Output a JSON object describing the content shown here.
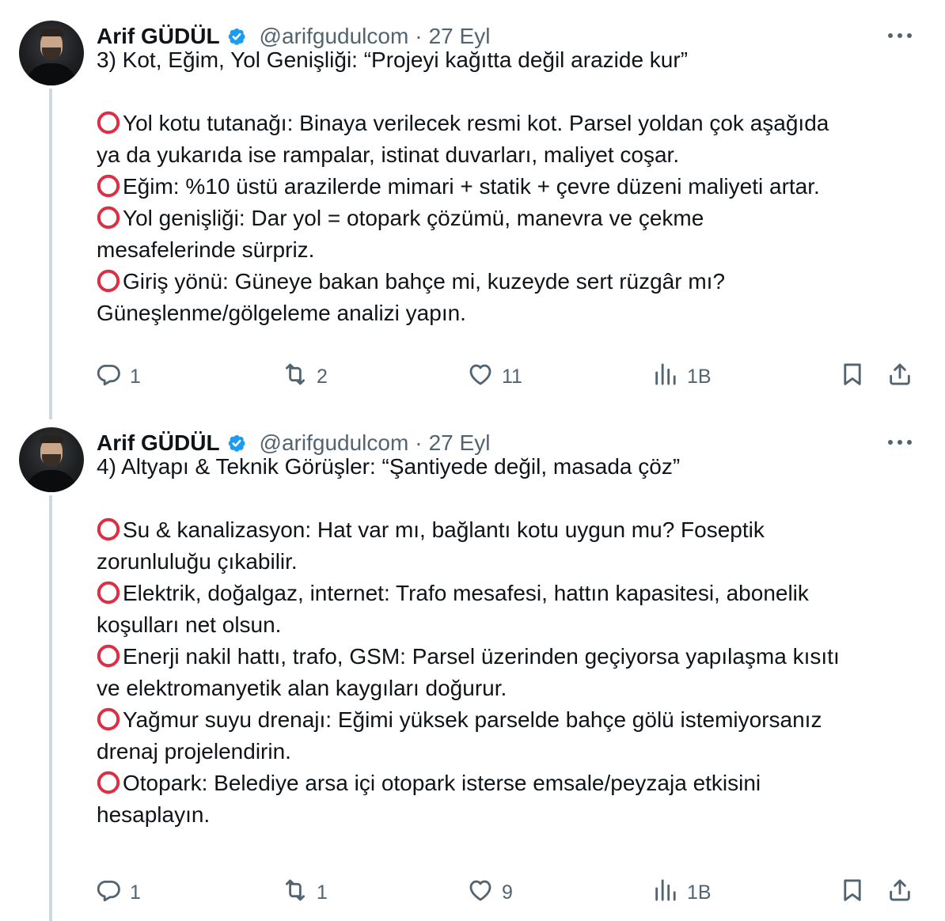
{
  "tweets": [
    {
      "author_name": "Arif GÜDÜL",
      "handle": "@arifgudulcom",
      "separator": "·",
      "date": "27 Eyl",
      "lines": [
        {
          "bullet": false,
          "text": "3) Kot, Eğim, Yol Genişliği: “Projeyi kağıtta değil arazide kur”"
        },
        {
          "bullet": false,
          "text": ""
        },
        {
          "bullet": true,
          "text": "Yol kotu tutanağı: Binaya verilecek resmi kot. Parsel yoldan çok aşağıda"
        },
        {
          "bullet": false,
          "text": "ya da yukarıda ise rampalar, istinat duvarları, maliyet coşar."
        },
        {
          "bullet": true,
          "text": "Eğim: %10 üstü arazilerde mimari + statik + çevre düzeni maliyeti artar."
        },
        {
          "bullet": true,
          "text": "Yol genişliği: Dar yol = otopark çözümü, manevra ve çekme"
        },
        {
          "bullet": false,
          "text": "mesafelerinde sürpriz."
        },
        {
          "bullet": true,
          "text": "Giriş yönü: Güneye bakan bahçe mi, kuzeyde sert rüzgâr mı?"
        },
        {
          "bullet": false,
          "text": "Güneşlenme/gölgeleme analizi yapın."
        }
      ],
      "replies": "1",
      "reposts": "2",
      "likes": "11",
      "views": "1B"
    },
    {
      "author_name": "Arif GÜDÜL",
      "handle": "@arifgudulcom",
      "separator": "·",
      "date": "27 Eyl",
      "lines": [
        {
          "bullet": false,
          "text": "4) Altyapı & Teknik Görüşler: “Şantiyede değil, masada çöz”"
        },
        {
          "bullet": false,
          "text": ""
        },
        {
          "bullet": true,
          "text": "Su & kanalizasyon: Hat var mı, bağlantı kotu uygun mu? Foseptik"
        },
        {
          "bullet": false,
          "text": "zorunluluğu çıkabilir."
        },
        {
          "bullet": true,
          "text": "Elektrik, doğalgaz, internet: Trafo mesafesi, hattın kapasitesi, abonelik"
        },
        {
          "bullet": false,
          "text": "koşulları net olsun."
        },
        {
          "bullet": true,
          "text": "Enerji nakil hattı, trafo, GSM: Parsel üzerinden geçiyorsa yapılaşma kısıtı"
        },
        {
          "bullet": false,
          "text": "ve elektromanyetik alan kaygıları doğurur."
        },
        {
          "bullet": true,
          "text": "Yağmur suyu drenajı: Eğimi yüksek parselde bahçe gölü istemiyorsanız"
        },
        {
          "bullet": false,
          "text": "drenaj projelendirin."
        },
        {
          "bullet": true,
          "text": "Otopark: Belediye arsa içi otopark isterse emsale/peyzaja etkisini"
        },
        {
          "bullet": false,
          "text": "hesaplayın."
        }
      ],
      "replies": "1",
      "reposts": "1",
      "likes": "9",
      "views": "1B"
    }
  ],
  "icons": {
    "verified": "verified-badge-icon",
    "more": "more-dots-icon",
    "reply": "reply-icon",
    "repost": "repost-icon",
    "like": "heart-icon",
    "views": "views-icon",
    "bookmark": "bookmark-icon",
    "share": "share-icon",
    "bullet": "red-circle-icon"
  },
  "colors": {
    "text": "#0f1419",
    "secondary": "#536471",
    "verified": "#1d9bf0",
    "bullet": "#dd2e44",
    "thread_line": "#cfd9de"
  }
}
